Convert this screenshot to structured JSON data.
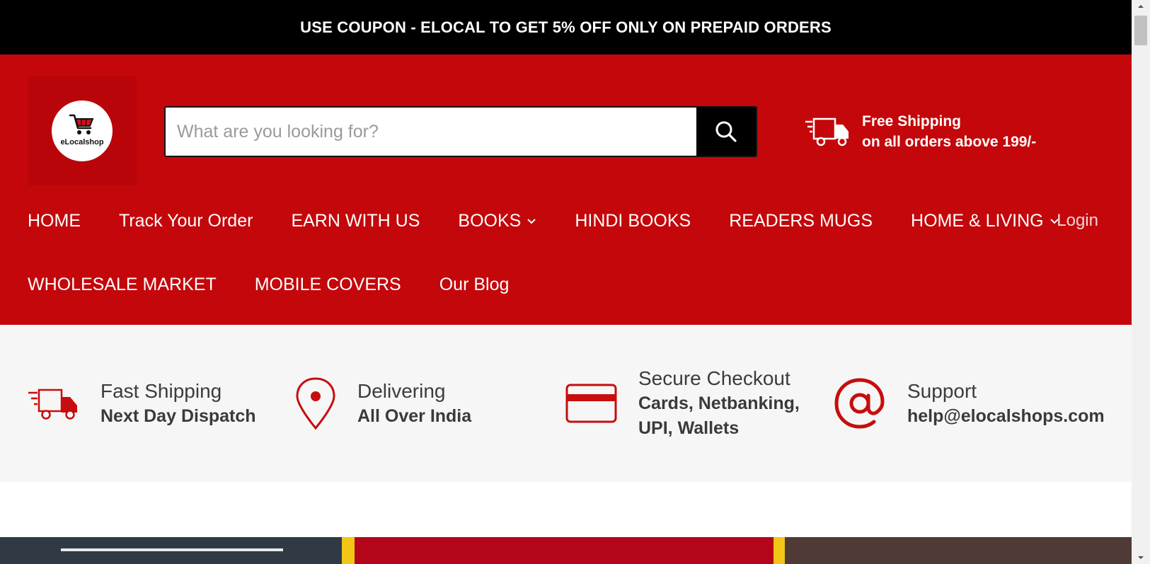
{
  "announcement": "USE COUPON - ELOCAL TO GET 5% OFF ONLY ON PREPAID ORDERS",
  "brand": {
    "logo_text": "eLocalshop"
  },
  "search": {
    "placeholder": "What are you looking for?",
    "value": ""
  },
  "shipping_promo": {
    "line1": "Free Shipping",
    "line2": "on all orders above 199/-"
  },
  "nav": {
    "row1": [
      {
        "label": "HOME",
        "dropdown": false
      },
      {
        "label": "Track Your Order",
        "dropdown": false
      },
      {
        "label": "EARN WITH US",
        "dropdown": false
      },
      {
        "label": "BOOKS",
        "dropdown": true
      },
      {
        "label": "HINDI BOOKS",
        "dropdown": false
      },
      {
        "label": "READERS MUGS",
        "dropdown": false
      },
      {
        "label": "HOME & LIVING",
        "dropdown": true
      }
    ],
    "row2": [
      {
        "label": "WHOLESALE MARKET"
      },
      {
        "label": "MOBILE COVERS"
      },
      {
        "label": "Our Blog"
      }
    ],
    "login": "Login"
  },
  "features": [
    {
      "icon": "delivery-truck-icon",
      "title": "Fast Shipping",
      "subtitle": "Next Day Dispatch"
    },
    {
      "icon": "location-pin-icon",
      "title": "Delivering",
      "subtitle": "All Over India"
    },
    {
      "icon": "credit-card-icon",
      "title": "Secure Checkout",
      "subtitle_line1": "Cards, Netbanking,",
      "subtitle_line2": "UPI, Wallets"
    },
    {
      "icon": "at-sign-icon",
      "title": "Support",
      "subtitle": "help@elocalshops.com"
    }
  ],
  "colors": {
    "brand_red": "#c4070b",
    "feature_red": "#c70d0d",
    "black": "#000000"
  }
}
